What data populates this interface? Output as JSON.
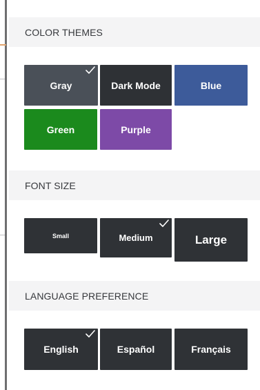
{
  "sections": {
    "color_themes": {
      "title": "COLOR THEMES",
      "options": [
        {
          "label": "Gray",
          "color": "#4a5058",
          "selected": true
        },
        {
          "label": "Dark Mode",
          "color": "#2e3135",
          "selected": false
        },
        {
          "label": "Blue",
          "color": "#3d5b9a",
          "selected": false
        },
        {
          "label": "Green",
          "color": "#1b8a1d",
          "selected": false
        },
        {
          "label": "Purple",
          "color": "#7d4aa7",
          "selected": false
        }
      ]
    },
    "font_size": {
      "title": "FONT SIZE",
      "options": [
        {
          "label": "Small",
          "selected": false
        },
        {
          "label": "Medium",
          "selected": true
        },
        {
          "label": "Large",
          "selected": false
        }
      ]
    },
    "language": {
      "title": "LANGUAGE PREFERENCE",
      "options": [
        {
          "label": "English",
          "selected": true
        },
        {
          "label": "Español",
          "selected": false
        },
        {
          "label": "Français",
          "selected": false
        }
      ]
    }
  },
  "icons": {
    "selected_marker": "check-icon"
  },
  "colors": {
    "section_header_bg": "#f4f4f5",
    "section_header_text": "#36383c",
    "tile_dark": "#2f3236",
    "tile_text": "#ffffff"
  }
}
